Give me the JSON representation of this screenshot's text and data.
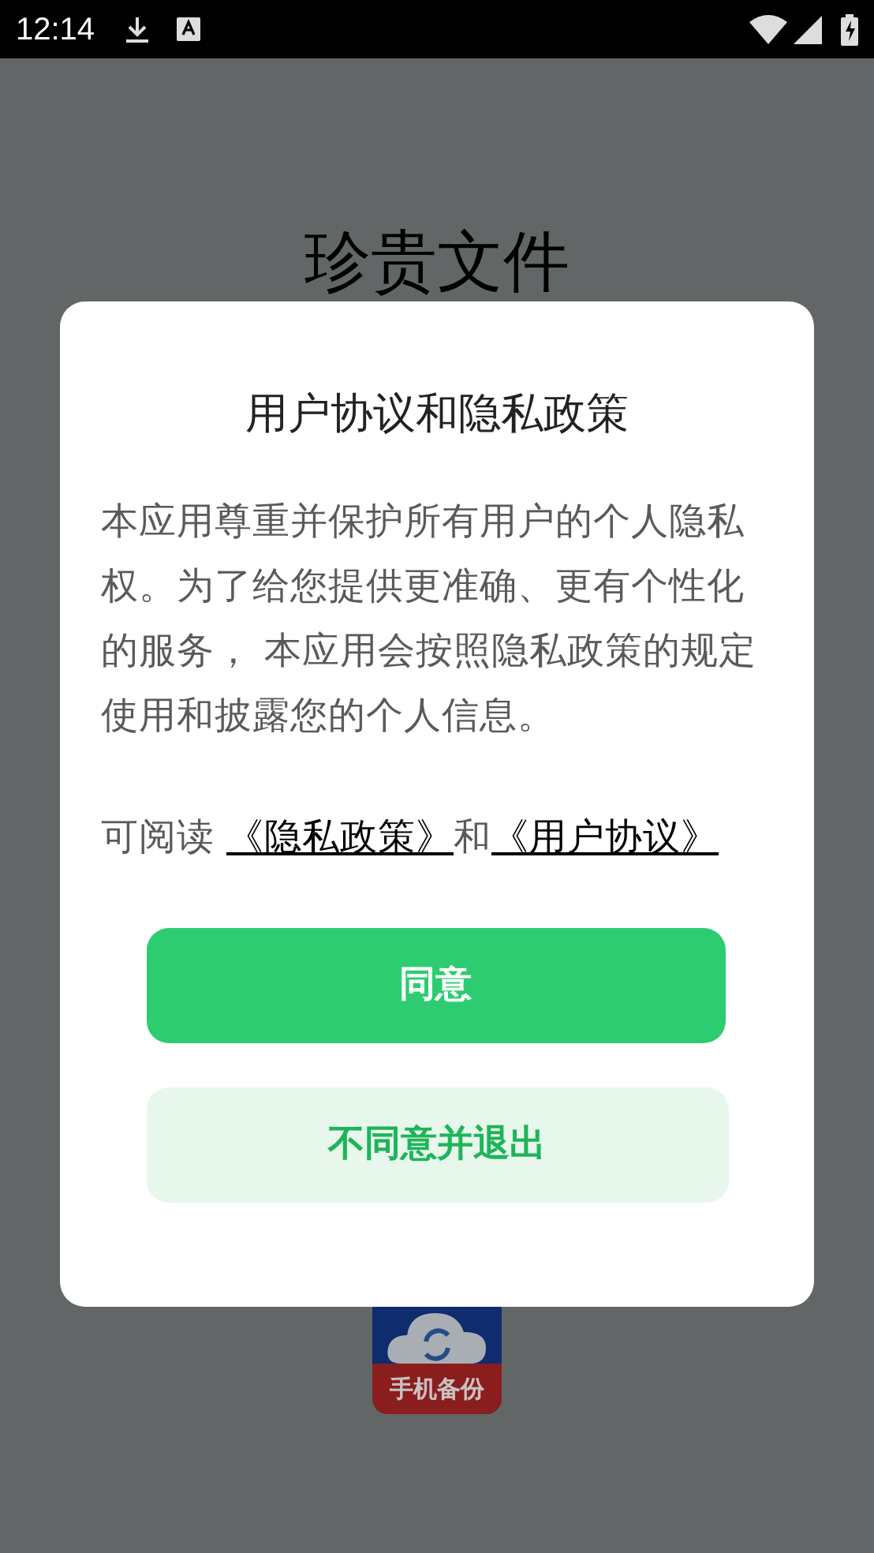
{
  "status_bar": {
    "time": "12:14"
  },
  "background": {
    "title": "珍贵文件",
    "app_label": "手机备份"
  },
  "dialog": {
    "title": "用户协议和隐私政策",
    "body": "本应用尊重并保护所有用户的个人隐私权。为了给您提供更准确、更有个性化的服务， 本应用会按照隐私政策的规定使用和披露您的个人信息。",
    "links_line": {
      "prefix": "可阅读 ",
      "privacy_link": "《隐私政策》",
      "joiner": "和",
      "terms_link": "《用户协议》"
    },
    "buttons": [
      {
        "kind": "primary",
        "label": "同意"
      },
      {
        "kind": "secondary",
        "label": "不同意并退出"
      }
    ]
  }
}
